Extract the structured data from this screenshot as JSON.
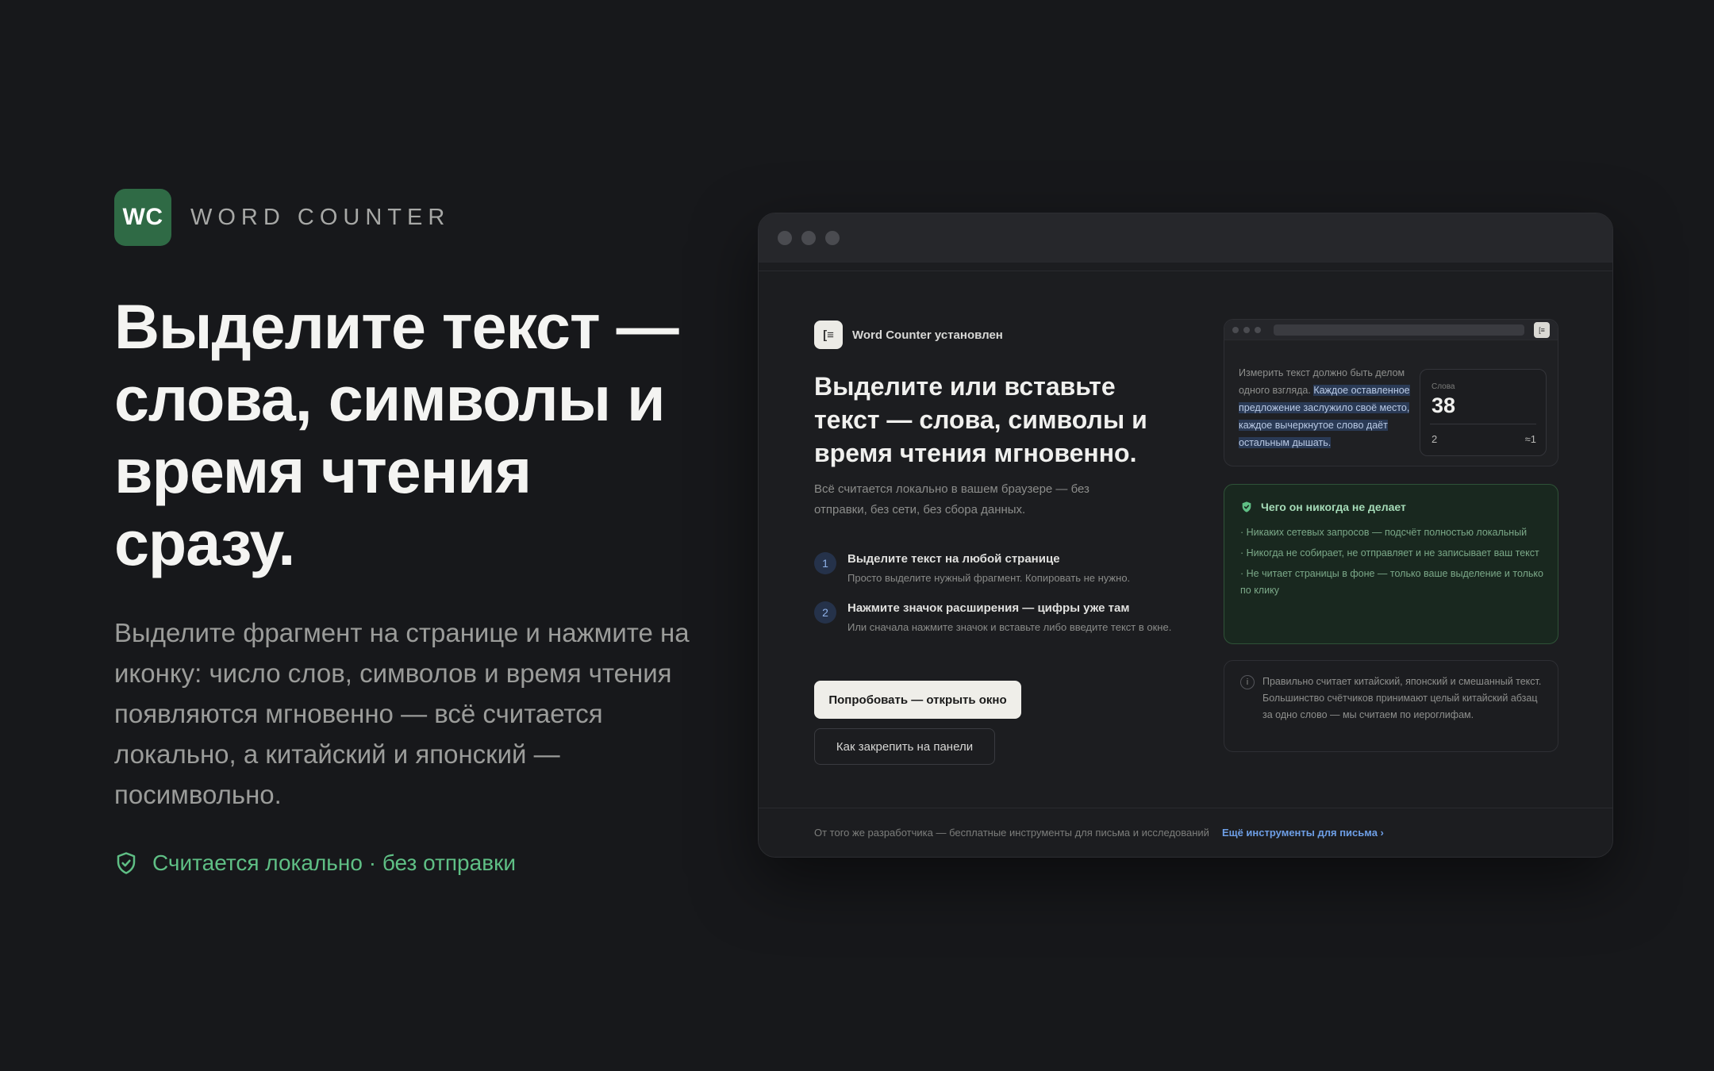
{
  "brand": {
    "logo": "WC",
    "name": "WORD COUNTER"
  },
  "hero": {
    "title": "Выделите текст — слова, символы и время чтения сразу.",
    "description": "Выделите фрагмент на странице и нажмите на иконку: число слов, символов и время чтения появляются мгновенно — всё считается локально, а китайский и японский — посимвольно.",
    "note": "Считается локально · без отправки",
    "note_icon": "shield-check-icon"
  },
  "popup": {
    "installed_icon": "[≡",
    "installed_label": "Word Counter установлен",
    "title": "Выделите или вставьте текст — слова, символы и время чтения мгновенно.",
    "subtitle": "Всё считается локально в вашем браузере — без отправки, без сети, без сбора данных.",
    "steps": [
      {
        "num": "1",
        "title": "Выделите текст на любой странице",
        "desc": "Просто выделите нужный фрагмент. Копировать не нужно."
      },
      {
        "num": "2",
        "title": "Нажмите значок расширения — цифры уже там",
        "desc": "Или сначала нажмите значок и вставьте либо введите текст в окне."
      }
    ],
    "primary_button": "Попробовать — открыть окно",
    "secondary_button": "Как закрепить на панели",
    "preview": {
      "text_plain": "Измерить текст должно быть делом одного взгляда. ",
      "text_highlight": "Каждое оставленное предложение заслужило своё место, каждое вычеркнутое слово даёт остальным дышать.",
      "ext_icon": "[≡",
      "counter_label": "Слова",
      "counter_value": "38",
      "counter_left": "2",
      "counter_right": "≈1"
    },
    "never": {
      "title": "Чего он никогда не делает",
      "items": [
        "· Никаких сетевых запросов — подсчёт полностью локальный",
        "· Никогда не собирает, не отправляет и не записывает ваш текст",
        "· Не читает страницы в фоне — только ваше выделение и только по клику"
      ]
    },
    "info": {
      "icon": "i",
      "text": "Правильно считает китайский, японский и смешанный текст. Большинство счётчиков принимают целый китайский абзац за одно слово — мы считаем по иероглифам."
    },
    "footer": {
      "text": "От того же разработчика — бесплатные инструменты для письма и исследований",
      "link": "Ещё инструменты для письма ›"
    }
  },
  "colors": {
    "background": "#17181b",
    "accent_green": "#5fbf85",
    "logo_green": "#2f6a45",
    "link_blue": "#6e9fe6"
  }
}
